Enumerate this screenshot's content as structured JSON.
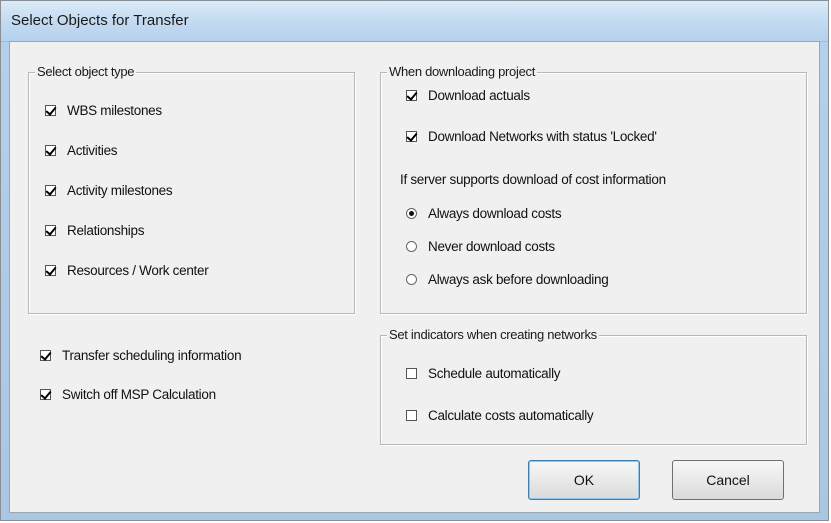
{
  "window": {
    "title": "Select Objects for Transfer"
  },
  "object_type_group": {
    "label": "Select object type",
    "items": [
      {
        "label": "WBS milestones",
        "checked": true
      },
      {
        "label": "Activities",
        "checked": true
      },
      {
        "label": "Activity milestones",
        "checked": true
      },
      {
        "label": "Relationships",
        "checked": true
      },
      {
        "label": "Resources / Work center",
        "checked": true
      }
    ]
  },
  "standalone_options": [
    {
      "label": "Transfer scheduling information",
      "checked": true
    },
    {
      "label": "Switch off MSP Calculation",
      "checked": true
    }
  ],
  "download_group": {
    "label": "When downloading project",
    "checks": [
      {
        "label": "Download actuals",
        "checked": true
      },
      {
        "label": "Download Networks with status 'Locked'",
        "checked": true
      }
    ],
    "cost_heading": "If server supports download of cost information",
    "radios": [
      {
        "label": "Always download costs",
        "selected": true
      },
      {
        "label": "Never download costs",
        "selected": false
      },
      {
        "label": "Always ask before downloading",
        "selected": false
      }
    ]
  },
  "indicators_group": {
    "label": "Set indicators when creating networks",
    "checks": [
      {
        "label": "Schedule automatically",
        "checked": false
      },
      {
        "label": "Calculate costs automatically",
        "checked": false
      }
    ]
  },
  "buttons": {
    "ok": "OK",
    "cancel": "Cancel"
  }
}
